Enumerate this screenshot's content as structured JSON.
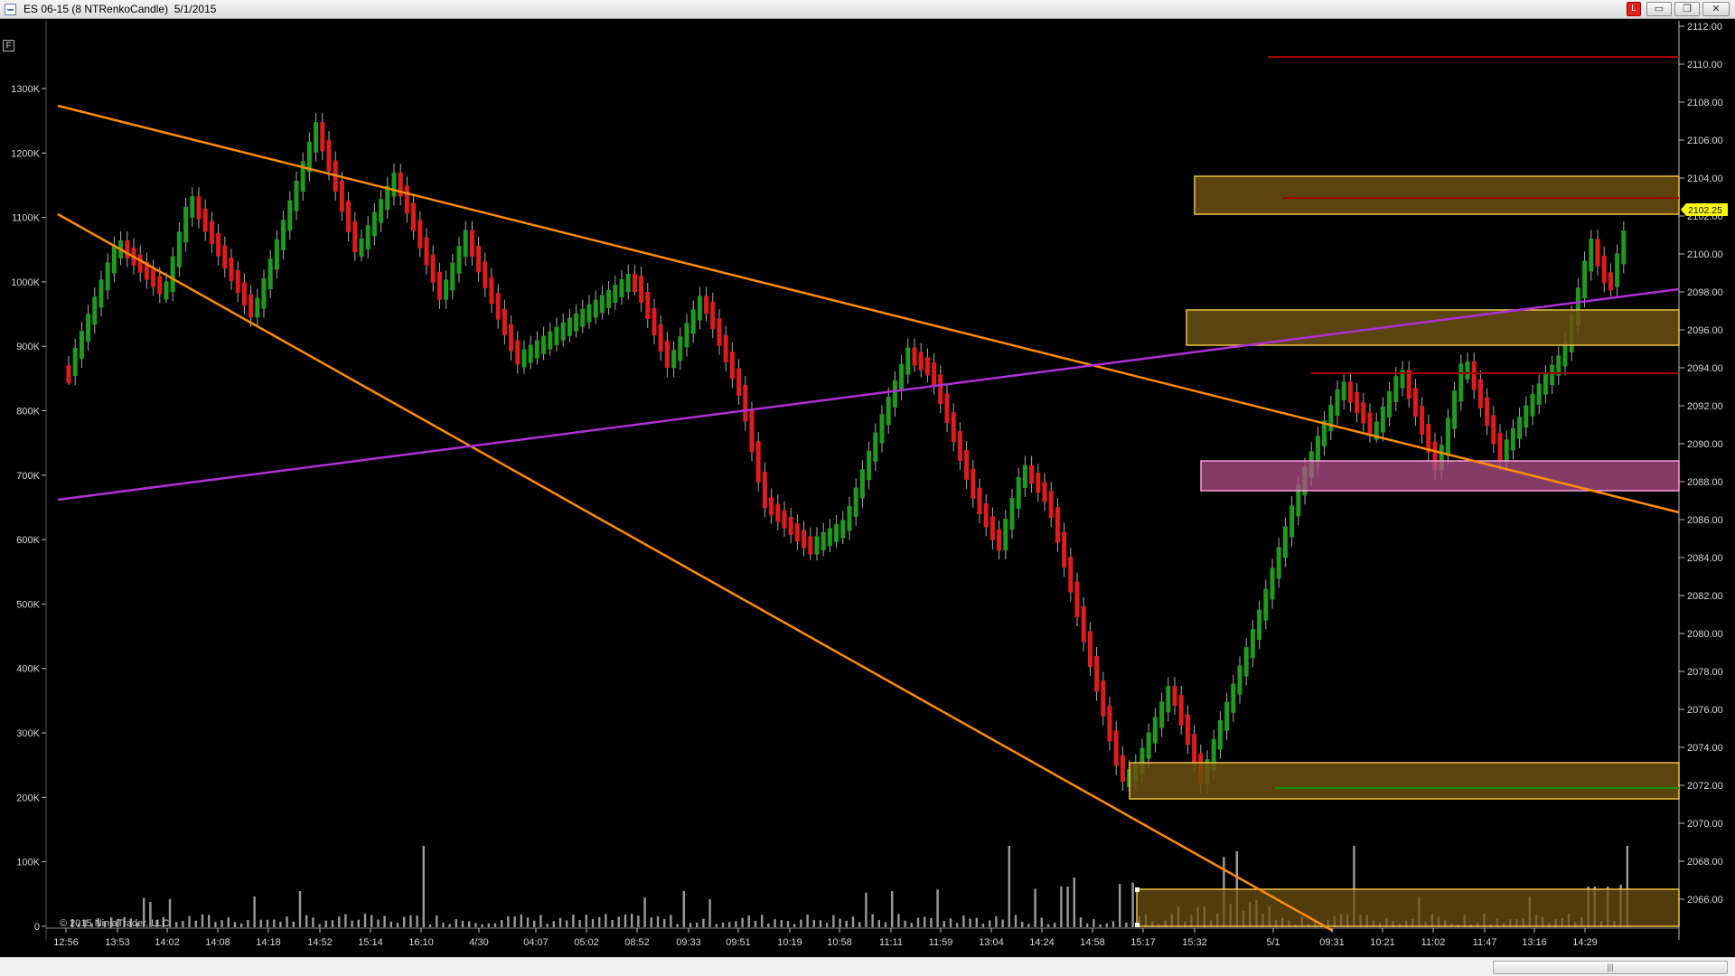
{
  "window": {
    "title": "ES 06-15 (8 NTRenkoCandle)  5/1/2015",
    "link_button": "L",
    "minimize": "▭",
    "maximize": "❐",
    "close": "✕"
  },
  "toolbar": {
    "properties_icon": "F"
  },
  "chart": {
    "copyright": "© 2015 NinjaTrader, LLC",
    "last_price": "2102.25",
    "price_axis_labels": [
      "2112.00",
      "2110.00",
      "2108.00",
      "2106.00",
      "2104.00",
      "2102.00",
      "2100.00",
      "2098.00",
      "2096.00",
      "2094.00",
      "2092.00",
      "2090.00",
      "2088.00",
      "2086.00",
      "2084.00",
      "2082.00",
      "2080.00",
      "2078.00",
      "2076.00",
      "2074.00",
      "2072.00",
      "2070.00",
      "2068.00",
      "2066.00"
    ],
    "volume_axis_labels": [
      "1300K",
      "1200K",
      "1100K",
      "1000K",
      "900K",
      "800K",
      "700K",
      "600K",
      "500K",
      "400K",
      "300K",
      "200K",
      "100K",
      "0"
    ],
    "time_axis_labels": [
      "12:56",
      "13:53",
      "14:02",
      "14:08",
      "14:18",
      "14:52",
      "15:14",
      "16:10",
      "4/30",
      "04:07",
      "05:02",
      "08:52",
      "09:33",
      "09:51",
      "10:19",
      "10:58",
      "11:11",
      "11:59",
      "13:04",
      "14:24",
      "14:58",
      "15:17",
      "15:32",
      "5/1",
      "09:31",
      "10:21",
      "11:02",
      "11:47",
      "13:16",
      "14:29"
    ],
    "colors": {
      "up_bar": "#1e9a1e",
      "down_bar": "#e01b1b",
      "trendline_orange": "#ff8c00",
      "trendline_purple": "#b030d8",
      "zone_fill": "#6b5010",
      "zone_border": "#f0c040",
      "pink_zone_fill": "#b0508a",
      "pink_zone_border": "#ff9ee0",
      "level_red": "#a00000",
      "level_green": "#109010",
      "volume_bar": "#9a9a9a",
      "price_marker": "#ffff00"
    }
  },
  "scrollbar": {
    "thumb_grip": "|||"
  }
}
